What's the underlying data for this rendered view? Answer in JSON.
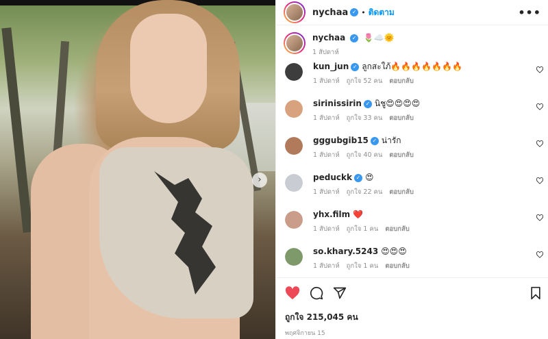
{
  "post": {
    "author": "nychaa",
    "follow_label": "ติดตาม",
    "more_label": "•••",
    "caption_emojis": "🌷☁️🌞",
    "caption_time": "1 สัปดาห์",
    "carousel_next": "›"
  },
  "comments": [
    {
      "user": "kun_jun",
      "verified": true,
      "text": "ลูกสะใภ้🔥🔥🔥🔥🔥🔥🔥",
      "time": "1 สัปดาห์",
      "likes": "ถูกใจ 52 คน",
      "reply": "ตอบกลับ",
      "avatar_color": "#3d3d3d"
    },
    {
      "user": "sirinissirin",
      "verified": true,
      "text": "นิชู😍😍😍😍",
      "time": "1 สัปดาห์",
      "likes": "ถูกใจ 33 คน",
      "reply": "ตอบกลับ",
      "avatar_color": "#d9a27f"
    },
    {
      "user": "gggubgib15",
      "verified": true,
      "text": "น่ารัก",
      "time": "1 สัปดาห์",
      "likes": "ถูกใจ 40 คน",
      "reply": "ตอบกลับ",
      "avatar_color": "#b07a5b"
    },
    {
      "user": "peduckk",
      "verified": true,
      "text": "😍",
      "time": "1 สัปดาห์",
      "likes": "ถูกใจ 22 คน",
      "reply": "ตอบกลับ",
      "avatar_color": "#c9ccd2"
    },
    {
      "user": "yhx.film",
      "verified": false,
      "text": "❤️",
      "time": "1 สัปดาห์",
      "likes": "ถูกใจ 1 คน",
      "reply": "ตอบกลับ",
      "avatar_color": "#c99d8a"
    },
    {
      "user": "so.khary.5243",
      "verified": false,
      "text": "😍😍😍",
      "time": "1 สัปดาห์",
      "likes": "ถูกใจ 1 คน",
      "reply": "ตอบกลับ",
      "avatar_color": "#7f9a6a"
    }
  ],
  "actions": {
    "likes_label": "ถูกใจ 215,045 คน",
    "date_label": "พฤศจิกายน 15"
  },
  "colors": {
    "accent": "#0095f6",
    "like_red": "#ed4956",
    "verified": "#3897f0"
  },
  "icons": [
    "heart-icon",
    "comment-icon",
    "share-icon",
    "bookmark-icon",
    "verified-badge-icon",
    "more-options-icon"
  ]
}
